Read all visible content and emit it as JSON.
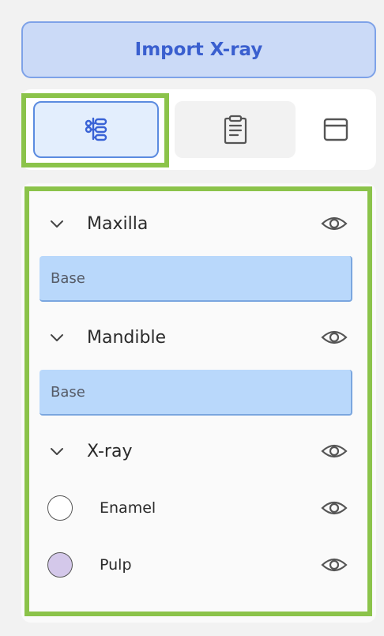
{
  "import_button": {
    "label": "Import X-ray"
  },
  "tabs": [
    {
      "name": "layers",
      "icon": "layers-tree-icon",
      "active": true
    },
    {
      "name": "notes",
      "icon": "clipboard-icon",
      "active": false
    },
    {
      "name": "panel",
      "icon": "window-panel-icon",
      "active": false
    }
  ],
  "layers": {
    "maxilla": {
      "label": "Maxilla",
      "base": "Base"
    },
    "mandible": {
      "label": "Mandible",
      "base": "Base"
    },
    "xray": {
      "label": "X-ray",
      "items": [
        {
          "label": "Enamel",
          "color": "#ffffff"
        },
        {
          "label": "Pulp",
          "color": "#d4c8ea"
        }
      ]
    }
  },
  "colors": {
    "accent": "#3a5fcf",
    "highlight": "#8bc34a",
    "base_fill": "#b9d8fb"
  }
}
